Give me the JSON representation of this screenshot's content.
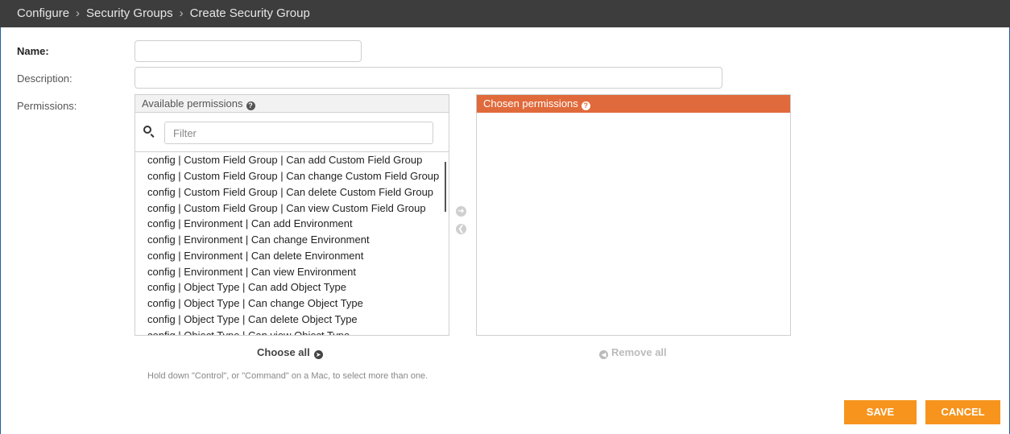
{
  "breadcrumb": {
    "items": [
      "Configure",
      "Security Groups",
      "Create Security Group"
    ],
    "separator": "›"
  },
  "form": {
    "name_label": "Name:",
    "description_label": "Description:",
    "permissions_label": "Permissions:",
    "name_value": "",
    "description_value": ""
  },
  "available": {
    "title": "Available permissions",
    "help_icon": "question-circle-icon",
    "filter_placeholder": "Filter",
    "items": [
      "config | Custom Field Group | Can add Custom Field Group",
      "config | Custom Field Group | Can change Custom Field Group",
      "config | Custom Field Group | Can delete Custom Field Group",
      "config | Custom Field Group | Can view Custom Field Group",
      "config | Environment | Can add Environment",
      "config | Environment | Can change Environment",
      "config | Environment | Can delete Environment",
      "config | Environment | Can view Environment",
      "config | Object Type | Can add Object Type",
      "config | Object Type | Can change Object Type",
      "config | Object Type | Can delete Object Type",
      "config | Object Type | Can view Object Type"
    ],
    "choose_all": "Choose all"
  },
  "chosen": {
    "title": "Chosen permissions",
    "help_icon": "question-circle-icon",
    "remove_all": "Remove all"
  },
  "help_text": "Hold down \"Control\", or \"Command\" on a Mac, to select more than one.",
  "buttons": {
    "save": "SAVE",
    "cancel": "CANCEL"
  },
  "colors": {
    "topbar": "#3d3d3d",
    "accent": "#f7941d",
    "chosen_header": "#e06a3b"
  }
}
